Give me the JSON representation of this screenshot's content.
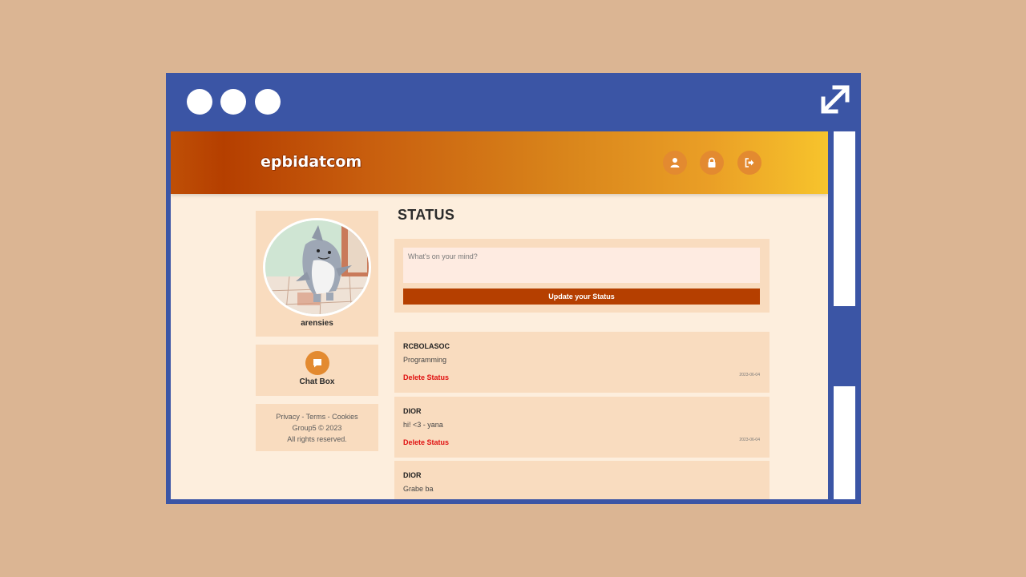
{
  "app": {
    "logo": "epbidatcom"
  },
  "header": {
    "icons": [
      "user-icon",
      "lock-icon",
      "logout-icon"
    ]
  },
  "profile": {
    "username": "arensies"
  },
  "chat": {
    "label": "Chat Box",
    "icon": "chat-icon"
  },
  "footer": {
    "links": "Privacy - Terms - Cookies",
    "copyright": "Group5 © 2023",
    "rights": "All rights reserved."
  },
  "status": {
    "title": "STATUS",
    "placeholder": "What's on your mind?",
    "update_label": "Update your Status"
  },
  "posts": [
    {
      "author": "RCBOLASOC",
      "text": "Programming",
      "delete_label": "Delete Status",
      "date": "2023-06-04"
    },
    {
      "author": "DIOR",
      "text": "hi! <3 - yana",
      "delete_label": "Delete Status",
      "date": "2023-06-04"
    },
    {
      "author": "DIOR",
      "text": "Grabe ba",
      "delete_label": "",
      "date": ""
    }
  ],
  "colors": {
    "page_bg": "#dbb593",
    "window_frame": "#3b55a5",
    "content_bg": "#fdeedd",
    "card_bg": "#f9dcbf",
    "accent": "#b53f00",
    "icon_bg": "#e38a30",
    "delete_red": "#e01010"
  }
}
